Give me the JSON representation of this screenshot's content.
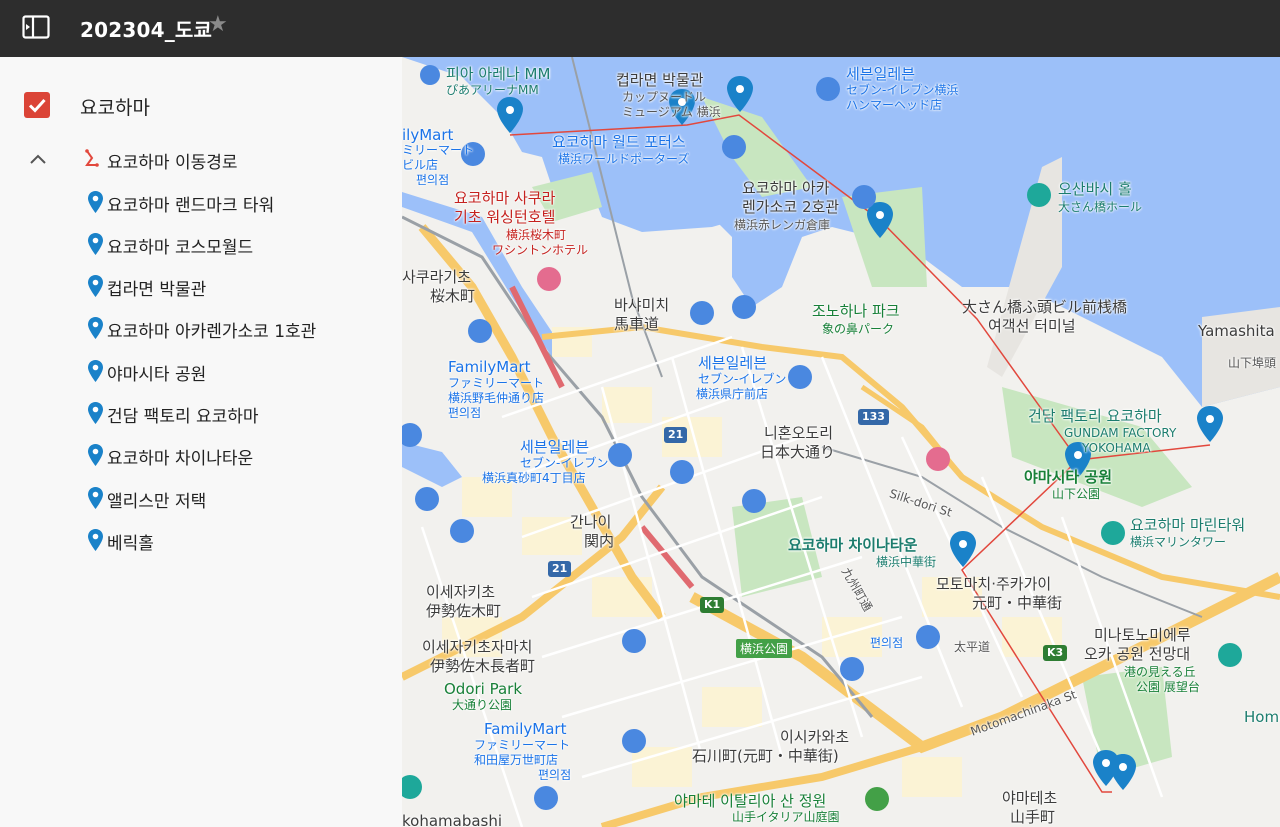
{
  "header": {
    "title": "202304_도쿄"
  },
  "sidebar": {
    "layer_name": "요코하마",
    "route_label": "요코하마 이동경로",
    "places": [
      {
        "label": "요코하마 랜드마크 타워"
      },
      {
        "label": "요코하마 코스모월드"
      },
      {
        "label": "컵라면 박물관"
      },
      {
        "label": "요코하마 아카렌가소코 1호관"
      },
      {
        "label": "야마시타 공원"
      },
      {
        "label": "건담 팩토리 요코하마"
      },
      {
        "label": "요코하마 차이나타운"
      },
      {
        "label": "앨리스만 저택"
      },
      {
        "label": "베릭홀"
      }
    ]
  },
  "map": {
    "labels": {
      "pia_arena_ko": "피아 아레나 MM",
      "pia_arena_ja": "ぴあアリーナMM",
      "cupnoodle_ko": "컵라면 박물관",
      "cupnoodle_ja1": "カップヌードル",
      "cupnoodle_ja2": "ミュージアム 横浜",
      "seven_hammer_ko": "세븐일레븐",
      "seven_hammer_ja1": "セブン-イレブン横浜",
      "seven_hammer_ja2": "ハンマーヘッド店",
      "familymart_top_en": "ilyMart",
      "familymart_top_ja": "ミリーマート",
      "familymart_top_ja2": "ビル店",
      "familymart_top_ko": "편의점",
      "world_porters_ko": "요코하마 월드 포터스",
      "world_porters_ja": "横浜ワールドポーターズ",
      "sakura_hotel_ko1": "요코하마 사쿠라",
      "sakura_hotel_ko2": "기초 워싱턴호텔",
      "sakura_hotel_ja1": "横浜桜木町",
      "sakura_hotel_ja2": "ワシントンホテル",
      "akarenga_ko1": "요코하마 아카",
      "akarenga_ko2": "렌가소코 2호관",
      "akarenga_ja": "横浜赤レンガ倉庫",
      "osanbashi_ko": "오산바시 홀",
      "osanbashi_ja": "大さん橋ホール",
      "sakuragicho_ko": "사쿠라기초",
      "sakuragicho_ja": "桜木町",
      "bashamichi_ko": "바샤미치",
      "bashamichi_ja": "馬車道",
      "zounohana_ko": "조노하나 파크",
      "zounohana_ja": "象の鼻パーク",
      "osanbashi_terminal_ja": "大さん橋ふ頭ビル前桟橋",
      "osanbashi_terminal_ko": "여객선 터미널",
      "yamashita_en": "Yamashita",
      "yamashita_ja": "山下埠頭",
      "familymart_nogeyama_en": "FamilyMart",
      "familymart_nogeyama_ja1": "ファミリーマート",
      "familymart_nogeyama_ja2": "横浜野毛仲通り店",
      "familymart_nogeyama_ko": "편의점",
      "seven_kenchou_ko": "세븐일레븐",
      "seven_kenchou_ja1": "セブン-イレブン",
      "seven_kenchou_ja2": "横浜県庁前店",
      "nihon_odori_ko": "니혼오도리",
      "nihon_odori_ja": "日本大通り",
      "gundam_ko": "건담 팩토리 요코하마",
      "gundam_en1": "GUNDAM FACTORY",
      "gundam_en2": "YOKOHAMA",
      "yamashita_park_ko": "야마시타 공원",
      "yamashita_park_ja": "山下公園",
      "seven_masago_ko": "세븐일레븐",
      "seven_masago_ja1": "セブン-イレブン",
      "seven_masago_ja2": "横浜真砂町4丁目店",
      "silk_dori": "Silk-dori St",
      "marine_tower_ko": "요코하마 마린타워",
      "marine_tower_ja": "横浜マリンタワー",
      "kannai_ko": "간나이",
      "kannai_ja": "関内",
      "chinatown_ko": "요코하마 차이나타운",
      "chinatown_ja": "横浜中華街",
      "kyushu_dori": "九州町通",
      "motomachi_ko": "모토마치·주카가이",
      "motomachi_ja": "元町・中華街",
      "isezakichojamachi_ko1": "이세자키초",
      "isezakichojamachi_ja1": "伊勢佐木町",
      "yokohama_park_tag": "横浜公園",
      "convenience_ko": "편의점",
      "taiheido": "太平道",
      "minatonomieru_ko1": "미나토노미에루",
      "minatonomieru_ko2": "오카 공원 전망대",
      "minatonomieru_ja1": "港の見える丘",
      "minatonomieru_ja2": "公園 展望台",
      "isezaki_chojamachi_ko": "이세자키초자마치",
      "isezaki_chojamachi_ja": "伊勢佐木長者町",
      "odori_park_en": "Odori Park",
      "odori_park_ja": "大通り公園",
      "motomachinaka_st": "Motomachinaka St",
      "home_en": "Home",
      "familymart_wada_en": "FamilyMart",
      "familymart_wada_ja1": "ファミリーマート",
      "familymart_wada_ja2": "和田屋万世町店",
      "familymart_wada_ko": "편의점",
      "ishikawacho_ko": "이시카와초",
      "ishikawacho_ja": "石川町(元町・中華街)",
      "yamate_italian_ko": "야마테 이탈리아 산 정원",
      "yamate_italian_ja": "山手イタリア山庭園",
      "yamate_ko": "야마테초",
      "yamate_ja": "山手町",
      "kohamabashi": "kohamabashi"
    },
    "shields": {
      "r133": "133",
      "r21a": "21",
      "r21b": "21",
      "k1": "K1",
      "k3": "K3"
    },
    "colors": {
      "water": "#9cc0f9",
      "land": "#f2f1ee",
      "park": "#c8e6c0",
      "highway": "#f7c96a",
      "route_line": "#e2483d",
      "pin": "#1a82c9",
      "checkbox": "#db4437"
    }
  }
}
